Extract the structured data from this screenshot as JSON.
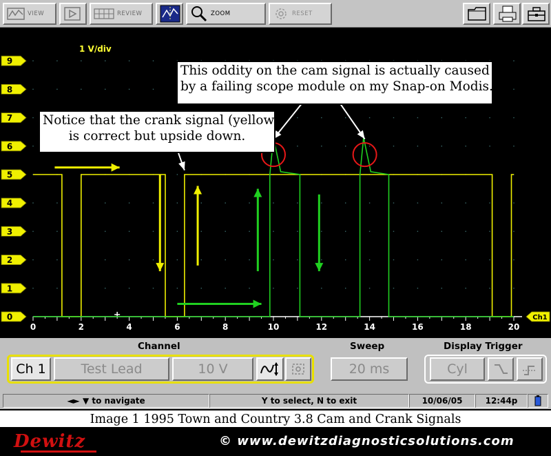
{
  "toolbar": {
    "view_label": "VIEW",
    "review_label": "REVIEW",
    "zoom_label": "ZOOM",
    "reset_label": "RESET"
  },
  "scope": {
    "volts_per_div": "1 V/div",
    "channel_marker": "Ch1",
    "y_ticks": [
      "0",
      "1",
      "2",
      "3",
      "4",
      "5",
      "6",
      "7",
      "8",
      "9"
    ],
    "x_ticks": [
      "0",
      "2",
      "4",
      "6",
      "8",
      "10",
      "12",
      "14",
      "16",
      "18",
      "20"
    ],
    "crank_color": "#f0f000",
    "cam_color": "#20d020",
    "annotation_color": "#e81818"
  },
  "callouts": {
    "cam_line1": "This oddity on the cam signal is actually caused",
    "cam_line2": "by a failing scope module on my Snap-on Modis.",
    "crank_line1": "Notice that the crank signal (yellow)",
    "crank_line2": "is correct but upside down."
  },
  "controls": {
    "channel_title": "Channel",
    "sweep_title": "Sweep",
    "trigger_title": "Display Trigger",
    "channel_value": "Ch 1",
    "lead_value": "Test Lead",
    "range_value": "10 V",
    "sweep_value": "20 ms",
    "trigger_value": "Cyl"
  },
  "status": {
    "navigate": "◄► ▼ to navigate",
    "select": "Y to select, N to exit",
    "date": "10/06/05",
    "time": "12:44p"
  },
  "caption": "Image 1 1995 Town and Country 3.8 Cam and Crank Signals",
  "footer": {
    "logo_text": "Dewitz",
    "website": "© www.dewitzdiagnosticsolutions.com"
  },
  "chart_data": {
    "type": "line",
    "title": "",
    "xlabel": "",
    "ylabel": "",
    "xlim": [
      0,
      20
    ],
    "ylim": [
      0,
      10
    ],
    "x_ticks": [
      0,
      2,
      4,
      6,
      8,
      10,
      12,
      14,
      16,
      18,
      20
    ],
    "y_ticks": [
      0,
      1,
      2,
      3,
      4,
      5,
      6,
      7,
      8,
      9
    ],
    "grid": true,
    "series": [
      {
        "points": [
          [
            0,
            5
          ],
          [
            1.2,
            5
          ],
          [
            1.2,
            0
          ],
          [
            2,
            0
          ],
          [
            2,
            5
          ],
          [
            5.5,
            5
          ],
          [
            5.5,
            0
          ],
          [
            6.3,
            0
          ],
          [
            6.3,
            5
          ],
          [
            19.1,
            5
          ],
          [
            19.1,
            0
          ],
          [
            19.9,
            0
          ],
          [
            19.9,
            5
          ],
          [
            20,
            5
          ]
        ]
      },
      {
        "points": [
          [
            0,
            0
          ],
          [
            9.85,
            0
          ],
          [
            9.85,
            5
          ],
          [
            10.0,
            6.3
          ],
          [
            10.3,
            5.1
          ],
          [
            11.1,
            5
          ],
          [
            11.1,
            0
          ],
          [
            13.6,
            0
          ],
          [
            13.6,
            5
          ],
          [
            13.75,
            6.3
          ],
          [
            14.05,
            5.1
          ],
          [
            14.8,
            5
          ],
          [
            14.8,
            0
          ],
          [
            20,
            0
          ]
        ]
      }
    ]
  }
}
